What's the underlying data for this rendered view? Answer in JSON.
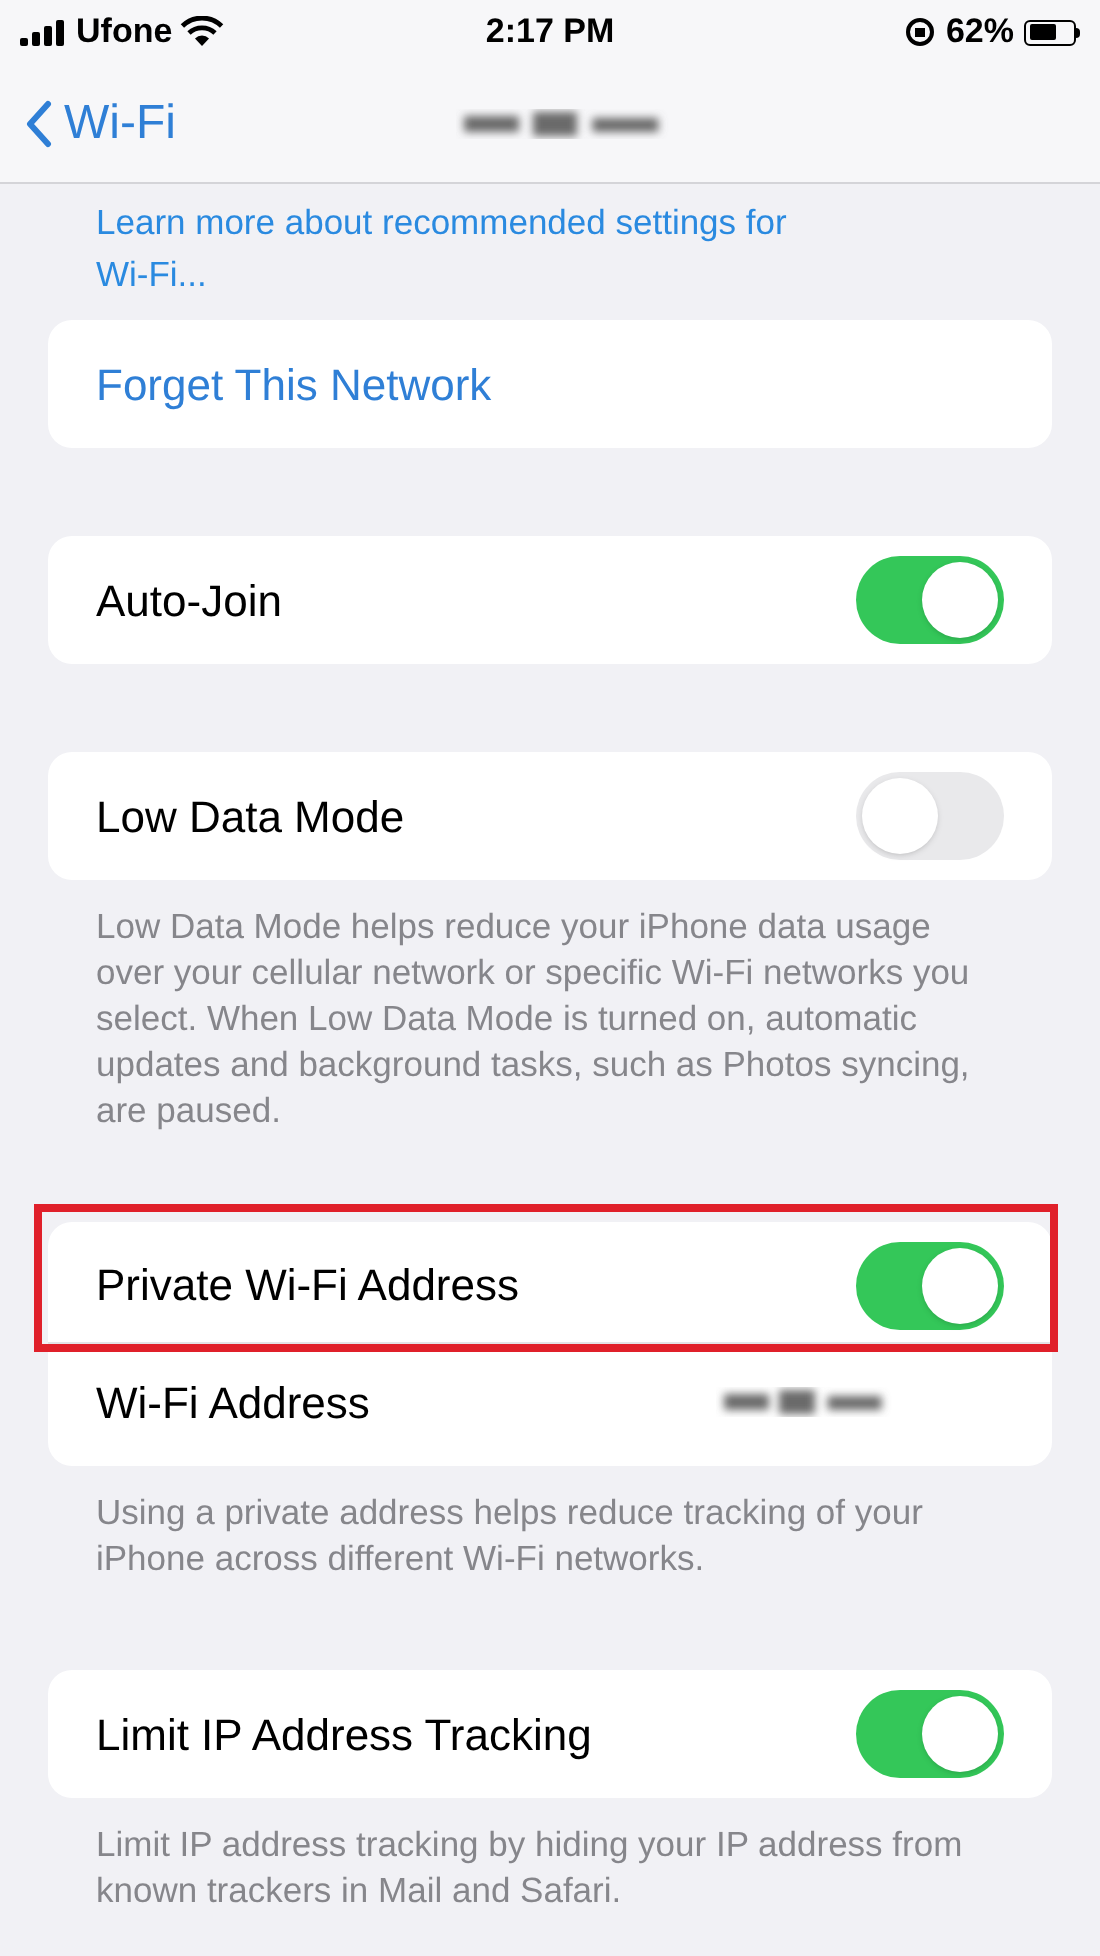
{
  "status_bar": {
    "carrier": "Ufone",
    "time": "2:17 PM",
    "battery": "62%"
  },
  "nav": {
    "back_label": "Wi-Fi"
  },
  "info_link": "Learn more about recommended settings for Wi-Fi...",
  "sections": [
    {
      "rows": [
        {
          "kind": "action",
          "label": "Forget This Network",
          "highlighted": false
        }
      ]
    },
    {
      "rows": [
        {
          "kind": "toggle",
          "label": "Auto-Join",
          "on": true,
          "highlighted": false
        }
      ]
    },
    {
      "rows": [
        {
          "kind": "toggle",
          "label": "Low Data Mode",
          "on": false,
          "highlighted": false
        }
      ],
      "footer": "Low Data Mode helps reduce your iPhone data usage over your cellular network or specific Wi-Fi networks you select. When Low Data Mode is turned on, automatic updates and background tasks, such as Photos syncing, are paused."
    },
    {
      "rows": [
        {
          "kind": "toggle",
          "label": "Private Wi-Fi Address",
          "on": true,
          "highlighted": true
        },
        {
          "kind": "value",
          "label": "Wi-Fi Address",
          "highlighted": false
        }
      ],
      "footer": "Using a private address helps reduce tracking of your iPhone across different Wi-Fi networks."
    },
    {
      "rows": [
        {
          "kind": "toggle",
          "label": "Limit IP Address Tracking",
          "on": true,
          "highlighted": false
        }
      ],
      "footer": "Limit IP address tracking by hiding your IP address from known trackers in Mail and Safari."
    }
  ]
}
